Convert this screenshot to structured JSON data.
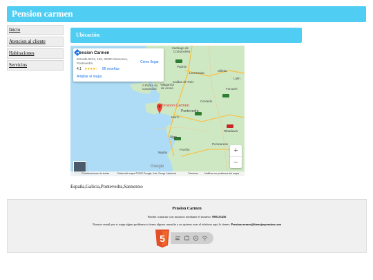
{
  "header": {
    "title": "Pension carmen"
  },
  "sidebar": {
    "items": [
      {
        "label": "Inicio"
      },
      {
        "label": "Atencion al cliente"
      },
      {
        "label": "Habitaciones"
      },
      {
        "label": "Servicios"
      }
    ]
  },
  "section": {
    "title": "Ubicación"
  },
  "map": {
    "card": {
      "name": "Pension Carmen",
      "address": "Estrada 9212, 169, 36990 Sanxenxo, Pontevedra",
      "rating": "4,1",
      "stars": "★★★★☆",
      "reviews": "86 reseñas",
      "directions": "Cómo llegar",
      "view_larger": "Ampliar el mapa"
    },
    "pin_label": "Pension Carmen",
    "zoom_in": "+",
    "zoom_out": "−",
    "google": "Google",
    "attribution": {
      "shortcuts": "Combinaciones de teclas",
      "map_data": "Datos del mapa ©2023 Google, Inst. Geogr. Nacional",
      "terms": "Términos",
      "report": "Notificar un problema del mapa"
    },
    "places": {
      "santiago": "Santiago de",
      "compostela": "Compostela",
      "padron": "Padrón",
      "laestrada": "La Estrada",
      "silleda": "Silleda",
      "lalin": "Lalín",
      "caldas": "Caldas de Reis",
      "vilagarcia": "Vilagarcía",
      "arosa": "de Arosa",
      "pobra": "A Pobra do",
      "caraminal": "Caramiñal",
      "pontevedra": "Pontevedra",
      "marin": "Marín",
      "vigo": "Vigo",
      "ponteareas": "Ponteareas",
      "porrino": "Porriño",
      "nigran": "Nigrán",
      "ribadavia": "Ribadavia",
      "forcarei": "Forcarei",
      "cerdedo": "Cerdedo"
    },
    "colors": {
      "water": "#aedcf6",
      "land": "#cfe8c4",
      "pin": "#ea4335"
    }
  },
  "location": {
    "text": "España,Galicia,Pontevedra,Sanxenxo"
  },
  "footer": {
    "name": "Pension Carmen",
    "phone_prefix": "Puedes contactar con nosotros mediante el numero:",
    "phone_number": "988123456",
    "email_prefix": "Nuestro email por si surge algun problema o tienes alguna consulta y no quieres usar el telefono aqui lo tienes:",
    "email_address": "Pensioncarmen@tienejorpension.com"
  },
  "badges": {
    "html5": "5"
  },
  "accent_color": "#4fcdf2"
}
